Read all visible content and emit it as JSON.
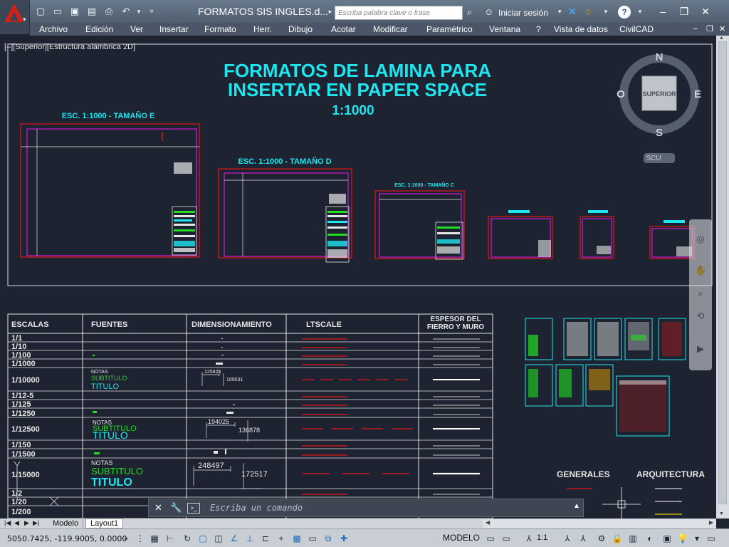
{
  "app": {
    "document_title": "FORMATOS SIS INGLES.d...",
    "search_placeholder": "Escriba palabra clave o frase",
    "signin_label": "Iniciar sesión"
  },
  "quick_access": [
    "new-icon",
    "open-icon",
    "save-icon",
    "saveas-icon",
    "print-icon",
    "undo-icon"
  ],
  "menu": [
    "Archivo",
    "Edición",
    "Ver",
    "Insertar",
    "Formato",
    "Herr.",
    "Dibujo",
    "Acotar",
    "Modificar",
    "Paramétrico",
    "Ventana",
    "?",
    "Vista de datos",
    "CivilCAD"
  ],
  "viewport": {
    "label": "[–][Superior][Estructura alámbrica 2D]",
    "main_title_1": "FORMATOS DE LAMINA PARA",
    "main_title_2": "INSERTAR EN PAPER SPACE",
    "main_scale": "1:1000",
    "sheet_e_label": "ESC. 1:1000 - TAMAÑO E",
    "sheet_d_label": "ESC. 1:1000 - TAMAÑO D",
    "sheet_c_label": "ESC. 1:1000 - TAMAÑO C"
  },
  "viewcube": {
    "face": "SUPERIOR",
    "north": "N",
    "south": "S",
    "east": "E",
    "west": "O",
    "ucs": "SCU"
  },
  "table": {
    "headers": [
      "ESCALAS",
      "FUENTES",
      "DIMENSIONAMIENTO",
      "LTSCALE",
      "ESPESOR DEL FIERRO Y MURO"
    ],
    "scales": [
      "1/1",
      "1/10",
      "1/100",
      "1/1000",
      "1/10000",
      "1/12-5",
      "1/125",
      "1/1250",
      "1/12500",
      "1/150",
      "1/1500",
      "1/15000",
      "1/2",
      "1/20",
      "1/200"
    ],
    "fonts": {
      "notas": "NOTAS",
      "subtitulo": "SUBTITULO",
      "titulo": "TITULO"
    },
    "dims": {
      "d1a": "125826",
      "d1b": "109031",
      "d2a": "194025",
      "d2b": "136878",
      "d3a": "248497",
      "d3b": "172517"
    }
  },
  "legend": {
    "generales": "GENERALES",
    "arquitectura": "ARQUITECTURA"
  },
  "command": {
    "placeholder": "Escriba un comando"
  },
  "layout_tabs": {
    "model": "Modelo",
    "layout1": "Layout1"
  },
  "status": {
    "coords": "5050.7425, -119.9005, 0.0000",
    "space": "MODELO",
    "scale": "1:1"
  },
  "colors": {
    "accent_cyan": "#1fe5f0",
    "frame_magenta": "#d21ad2",
    "frame_red": "#e01818",
    "line_white": "#ffffff",
    "green": "#22dd22"
  }
}
